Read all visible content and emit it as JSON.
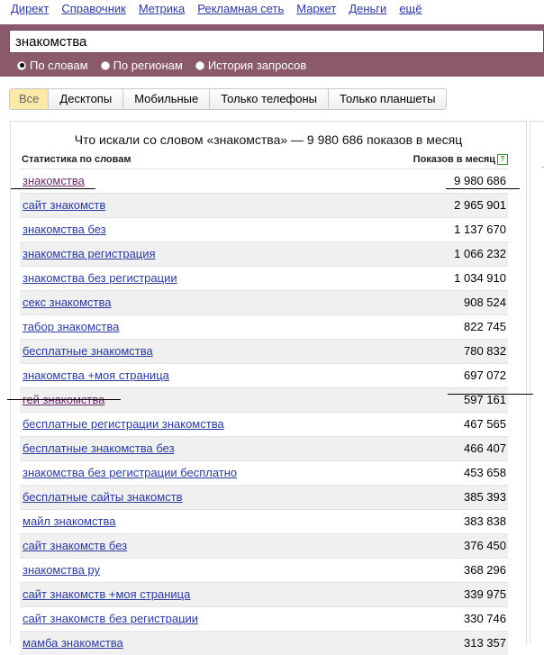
{
  "nav": [
    "Директ",
    "Справочник",
    "Метрика",
    "Рекламная сеть",
    "Маркет",
    "Деньги",
    "ещё"
  ],
  "search": {
    "value": "знакомства"
  },
  "radios": [
    {
      "label": "По словам",
      "checked": true
    },
    {
      "label": "По регионам",
      "checked": false
    },
    {
      "label": "История запросов",
      "checked": false
    }
  ],
  "filters": [
    {
      "label": "Все",
      "active": true
    },
    {
      "label": "Десктопы",
      "active": false
    },
    {
      "label": "Мобильные",
      "active": false
    },
    {
      "label": "Только телефоны",
      "active": false
    },
    {
      "label": "Только планшеты",
      "active": false
    }
  ],
  "panel": {
    "title": "Что искали со словом «знакомства» — 9 980 686 показов в месяц",
    "col_left": "Статистика по словам",
    "col_right": "Показов в месяц",
    "help": "?"
  },
  "rows": [
    {
      "phrase": "знакомства",
      "count": "9 980 686",
      "visited": true
    },
    {
      "phrase": "сайт знакомств",
      "count": "2 965 901"
    },
    {
      "phrase": "знакомства без",
      "count": "1 137 670"
    },
    {
      "phrase": "знакомства регистрация",
      "count": "1 066 232"
    },
    {
      "phrase": "знакомства без регистрации",
      "count": "1 034 910"
    },
    {
      "phrase": "секс знакомства",
      "count": "908 524"
    },
    {
      "phrase": "табор знакомства",
      "count": "822 745"
    },
    {
      "phrase": "бесплатные знакомства",
      "count": "780 832"
    },
    {
      "phrase": "знакомства +моя страница",
      "count": "697 072"
    },
    {
      "phrase": "гей знакомства",
      "count": "597 161",
      "visited": true
    },
    {
      "phrase": "бесплатные регистрации знакомства",
      "count": "467 565"
    },
    {
      "phrase": "бесплатные знакомства без",
      "count": "466 407"
    },
    {
      "phrase": "знакомства без регистрации бесплатно",
      "count": "453 658"
    },
    {
      "phrase": "бесплатные сайты знакомств",
      "count": "385 393"
    },
    {
      "phrase": "майл знакомства",
      "count": "383 838"
    },
    {
      "phrase": "сайт знакомств без",
      "count": "376 450"
    },
    {
      "phrase": "знакомства ру",
      "count": "368 296"
    },
    {
      "phrase": "сайт знакомств +моя страница",
      "count": "339 975"
    },
    {
      "phrase": "сайт знакомств без регистрации",
      "count": "330 746"
    },
    {
      "phrase": "мамба знакомства",
      "count": "313 357"
    }
  ],
  "colors": {
    "searchbar": "#8a5a6c",
    "link": "#2a3a9e",
    "visited": "#6b2a6b",
    "active_filter": "#fbe9a8"
  }
}
